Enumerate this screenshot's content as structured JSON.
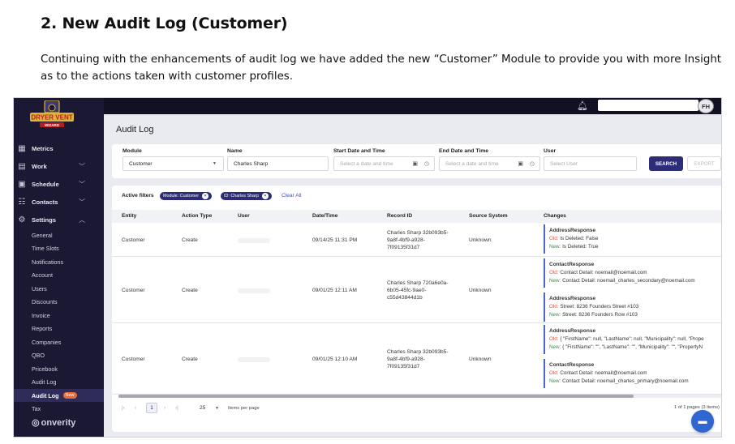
{
  "document": {
    "heading": "2.  New Audit Log (Customer)",
    "paragraph": "Continuing with the enhancements of audit log we have added the new “Customer” Module to provide you with more Insight as to the actions taken with customer profiles."
  },
  "app": {
    "logo_text": "DRYER VENT",
    "logo_subtext": "WIZARD",
    "avatar_initials": "FH",
    "page_title": "Audit Log",
    "brand": "onverity"
  },
  "sidebar": {
    "main_items": [
      {
        "label": "Metrics",
        "icon": "chart-icon"
      },
      {
        "label": "Work",
        "icon": "grid-icon"
      },
      {
        "label": "Schedule",
        "icon": "calendar-icon"
      },
      {
        "label": "Contacts",
        "icon": "people-icon"
      },
      {
        "label": "Settings",
        "icon": "gear-icon"
      }
    ],
    "settings_items": [
      "General",
      "Time Slots",
      "Notifications",
      "Account",
      "Users",
      "Discounts",
      "Invoice",
      "Reports",
      "Companies",
      "QBO",
      "Pricebook",
      "Audit Log",
      "Audit Log",
      "Tax"
    ],
    "new_badge": "New"
  },
  "filters": {
    "module_label": "Module",
    "module_value": "Customer",
    "name_label": "Name",
    "name_value": "Charles Sharp",
    "start_label": "Start Date and Time",
    "start_placeholder": "Select a date and time",
    "end_label": "End Date and Time",
    "end_placeholder": "Select a date and time",
    "user_label": "User",
    "user_placeholder": "Select User",
    "search_button": "SEARCH",
    "export_button": "EXPORT"
  },
  "active_filters": {
    "label": "Active filters",
    "chips": [
      "Module: Customer",
      "ID: Charles Sharp"
    ],
    "clear_all": "Clear All"
  },
  "table": {
    "headers": [
      "Entity",
      "Action Type",
      "User",
      "Date/Time",
      "Record ID",
      "Source System",
      "Changes"
    ],
    "old_tag": "Old:",
    "new_tag": "New:",
    "rows": [
      {
        "entity": "Customer",
        "action": "Create",
        "datetime": "09/14/25 11:31 PM",
        "record_id": [
          "Charles Sharp 32b093b5-",
          "9a8f-4bf9-a928-",
          "7f09135f31d7"
        ],
        "source": "Unknown",
        "changes": [
          {
            "entity": "AddressResponse",
            "old": "Is Deleted: False",
            "new": "Is Deleted: True"
          }
        ]
      },
      {
        "entity": "Customer",
        "action": "Create",
        "datetime": "09/01/25 12:11 AM",
        "record_id": [
          "Charles Sharp 720a6e0a-",
          "6b05-45fc-9ae0-",
          "c55d43844d1b"
        ],
        "source": "Unknown",
        "changes": [
          {
            "entity": "ContactResponse",
            "old": "Contact Detail: noemail@noemail.com",
            "new": "Contact Detail: noemail_charles_secondary@noemail.com"
          },
          {
            "entity": "AddressResponse",
            "old": "Street: 8236 Founders Street #103",
            "new": "Street: 8236 Founders Row #103"
          }
        ]
      },
      {
        "entity": "Customer",
        "action": "Create",
        "datetime": "09/01/25 12:10 AM",
        "record_id": [
          "Charles Sharp 32b093b5-",
          "9a8f-4bf9-a928-",
          "7f09135f31d7"
        ],
        "source": "Unknown",
        "changes": [
          {
            "entity": "AddressResponse",
            "old": "{  \"FirstName\": null,  \"LastName\": null,  \"Municipality\": null,  \"Prope",
            "new": "{  \"FirstName\": \"\",  \"LastName\": \"\",  \"Municipality\": \"\",  \"PropertyN"
          },
          {
            "entity": "ContactResponse",
            "old": "Contact Detail: noemail@noemail.com",
            "new": "Contact Detail: noemail_charles_primary@noemail.com"
          }
        ]
      }
    ]
  },
  "pagination": {
    "first": "|‹",
    "prev": "‹",
    "current_page": "1",
    "next": "›",
    "last": "›|",
    "page_size": "25",
    "items_label": "Items per page",
    "summary": "1 of 1 pages (3 items)"
  }
}
